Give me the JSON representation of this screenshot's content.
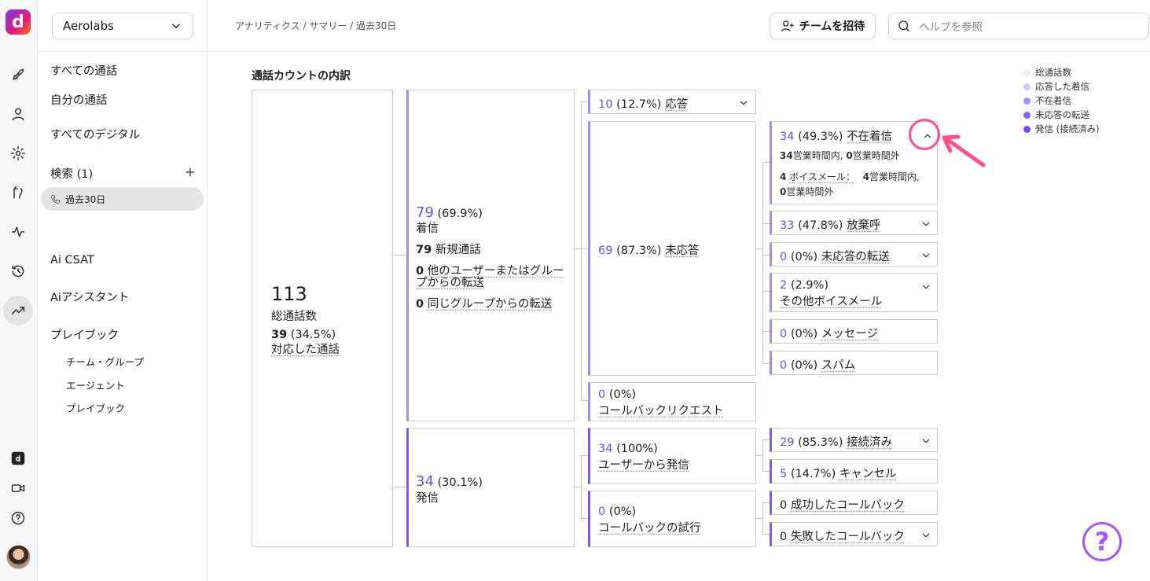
{
  "sidebar": {
    "workspace": "Aerolabs",
    "nav": {
      "all_calls": "すべての通話",
      "my_calls": "自分の通話",
      "all_digital": "すべてのデジタル",
      "search": "検索 (1)",
      "saved_search": "過去30日",
      "ai_csat": "Ai CSAT",
      "ai_assistant": "Aiアシスタント",
      "playbook": "プレイブック",
      "team_group": "チーム・グループ",
      "agent": "エージェント",
      "playbook_sub": "プレイブック"
    }
  },
  "header": {
    "breadcrumb": "アナリティクス / サマリー / 過去30日",
    "invite": "チームを招待",
    "help_placeholder": "ヘルプを参照"
  },
  "chart": {
    "title": "通話カウントの内訳",
    "total": {
      "value": "113",
      "label": "総通話数",
      "answered_value": "39",
      "answered_pct": "(34.5%)",
      "answered_label": "対応した通話"
    },
    "incoming": {
      "value": "79",
      "pct": "(69.9%)",
      "label": "着信",
      "new_value": "79",
      "new_label": "新規通話",
      "transfer_value": "0",
      "transfer_label_1": "他のユーザーまたはグルー",
      "transfer_label_2": "プからの転送",
      "same_value": "0",
      "same_label": "同じグループからの転送"
    },
    "outgoing": {
      "value": "34",
      "pct": "(30.1%)",
      "label": "発信"
    },
    "answered": {
      "value": "10",
      "pct": "(12.7%)",
      "label": "応答"
    },
    "unanswered": {
      "value": "69",
      "pct": "(87.3%)",
      "label": "未応答"
    },
    "callback_req": {
      "value": "0",
      "pct": "(0%)",
      "label": "コールバックリクエスト"
    },
    "user_outgoing": {
      "value": "34",
      "pct": "(100%)",
      "label": "ユーザーから発信"
    },
    "callback_try": {
      "value": "0",
      "pct": "(0%)",
      "label": "コールバックの試行"
    },
    "missed": {
      "value": "34",
      "pct": "(49.3%)",
      "label": "不在着信",
      "biz_value": "34",
      "biz_label": "営業時間内, ",
      "off_value": "0",
      "off_label": "営業時間外",
      "vm_value": "4",
      "vm_label": "ボイスメール：",
      "vm_biz_value": "4",
      "vm_biz_label": "営業時間内,",
      "vm_off_value": "0",
      "vm_off_label": "営業時間外"
    },
    "abandoned": {
      "value": "33",
      "pct": "(47.8%)",
      "label": "放棄呼"
    },
    "unanswered_transfer": {
      "value": "0",
      "pct": "(0%)",
      "label": "未応答の転送"
    },
    "other_vm": {
      "value": "2",
      "pct": "(2.9%)",
      "label": "その他ボイスメール"
    },
    "message": {
      "value": "0",
      "pct": "(0%)",
      "label": "メッセージ"
    },
    "spam": {
      "value": "0",
      "pct": "(0%)",
      "label": "スパム"
    },
    "connected": {
      "value": "29",
      "pct": "(85.3%)",
      "label": "接続済み"
    },
    "cancel": {
      "value": "5",
      "pct": "(14.7%)",
      "label": "キャンセル"
    },
    "cb_success": {
      "value": "0",
      "label": "成功したコールバック"
    },
    "cb_fail": {
      "value": "0",
      "label": "失敗したコールバック"
    }
  },
  "legend": [
    {
      "label": "総通話数",
      "color": "#efedfb"
    },
    {
      "label": "応答した着信",
      "color": "#cfc7f7"
    },
    {
      "label": "不在着信",
      "color": "#a895f2"
    },
    {
      "label": "未応答の転送",
      "color": "#8465ee"
    },
    {
      "label": "発信 (接続済み)",
      "color": "#6d4be8"
    }
  ],
  "help_fab": "?"
}
